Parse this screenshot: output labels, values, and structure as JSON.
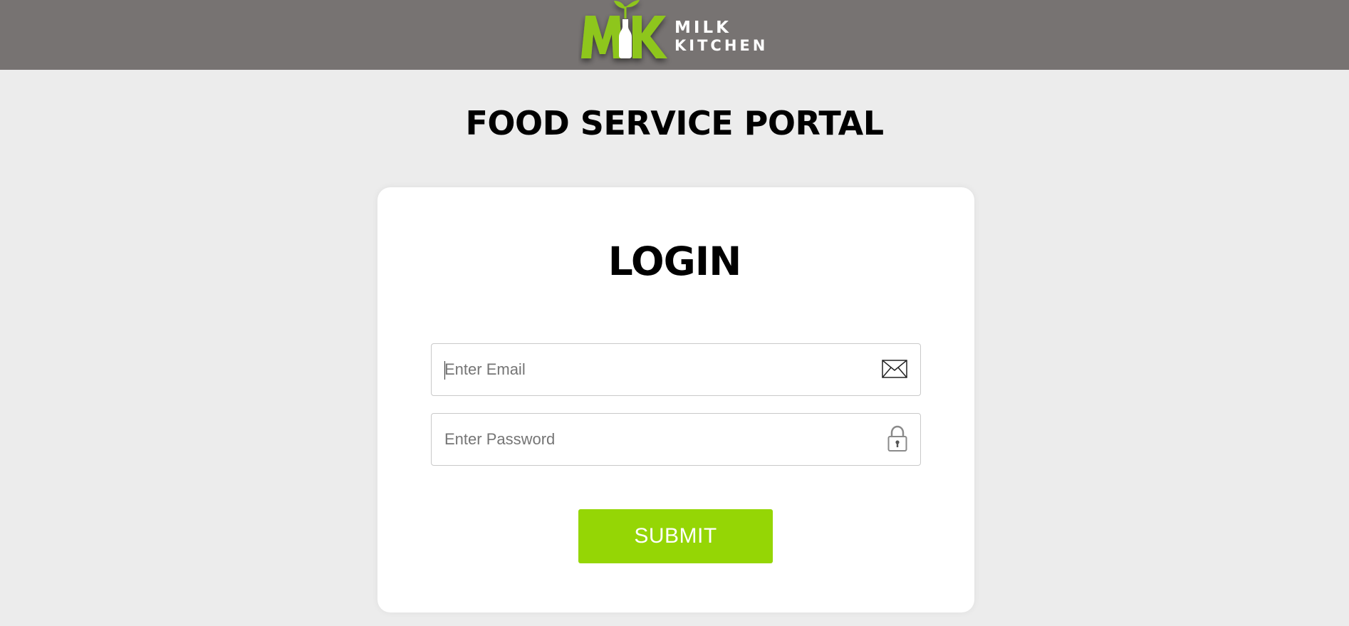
{
  "header": {
    "logo": {
      "monogram": "MK",
      "word1": "MILK",
      "word2": "KITCHEN"
    },
    "background_color": "#777372"
  },
  "page": {
    "title": "FOOD SERVICE PORTAL",
    "background_color": "#ececec"
  },
  "login_card": {
    "title": "LOGIN",
    "email": {
      "placeholder": "Enter Email",
      "value": "",
      "icon": "envelope-icon"
    },
    "password": {
      "placeholder": "Enter Password",
      "value": "",
      "icon": "lock-icon"
    },
    "submit_label": "SUBMIT",
    "accent_color": "#95d605"
  }
}
